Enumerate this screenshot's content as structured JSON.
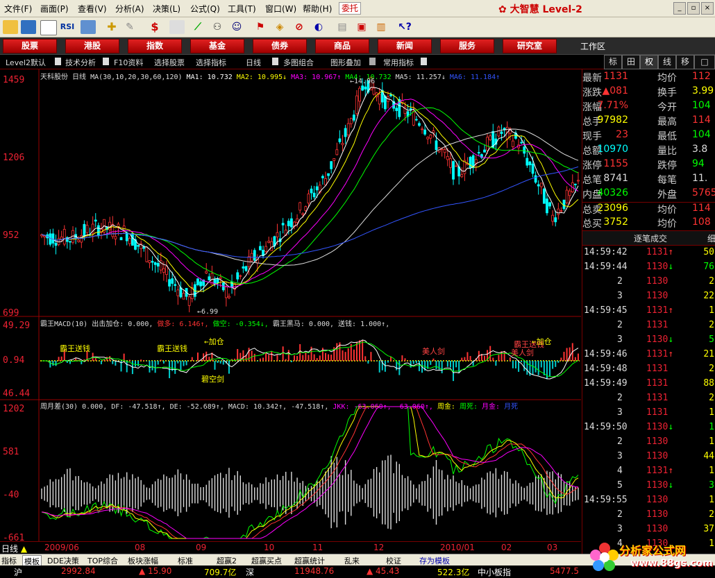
{
  "menu": [
    "文件(F)",
    "画面(P)",
    "查看(V)",
    "分析(A)",
    "决策(L)",
    "公式(Q)",
    "工具(T)",
    "窗口(W)",
    "帮助(H)"
  ],
  "weituo": "委托",
  "brand": {
    "name": "大智慧",
    "level": "Level-2"
  },
  "nav": [
    "股票",
    "港股",
    "指数",
    "基金",
    "债券",
    "商品",
    "新闻",
    "服务",
    "研究室"
  ],
  "workspace": "工作区",
  "subtabs": [
    "Level2默认",
    "技术分析",
    "F10资料",
    "选择股票",
    "选择指标",
    "日线",
    "多图组合",
    "图形叠加",
    "常用指标"
  ],
  "right_tabs": [
    "标",
    "田",
    "权",
    "线",
    "移",
    "□"
  ],
  "chart": {
    "stock_title": "天科股份 日线",
    "ma_params": "MA(30,10,20,30,60,120)",
    "ma_values": [
      {
        "label": "MA1: 10.732",
        "color": "#ffffff"
      },
      {
        "label": "MA2: 10.995↓",
        "color": "#ffff00"
      },
      {
        "label": "MA3: 10.967↑",
        "color": "#ff00ff"
      },
      {
        "label": "MA4: 10.732",
        "color": "#00ff00"
      },
      {
        "label": "MA5: 11.257↓",
        "color": "#dddddd"
      },
      {
        "label": "MA6: 11.184↑",
        "color": "#3355ff"
      }
    ],
    "price_labels": [
      "1459",
      "1206",
      "952",
      "699"
    ],
    "high_mark": "←14.96",
    "low_mark": "←6.99",
    "macd_title": "霸王MACD(10)",
    "macd_legend": [
      {
        "label": "出击加仓: 0.000,",
        "color": "#dddddd"
      },
      {
        "label": "做多: 6.146↑,",
        "color": "#ff3333"
      },
      {
        "label": "做空: -0.354↓,",
        "color": "#00ff00"
      },
      {
        "label": "霸王黑马: 0.000,",
        "color": "#dddddd"
      },
      {
        "label": "送钱: 1.000↑,",
        "color": "#dddddd"
      }
    ],
    "macd_labels": [
      "49.29",
      "0.94",
      "46.44"
    ],
    "macd_annotations": [
      "霸王送钱",
      "霸王送钱",
      "←加仓",
      "碧空剑",
      "美人剑",
      "霸王送钱",
      "←加仓",
      "美人剑"
    ],
    "zcy_title": "周月差(30)",
    "zcy_legend": [
      {
        "label": "0.000,",
        "color": "#dddddd"
      },
      {
        "label": "DF: -47.518↑,",
        "color": "#dddddd"
      },
      {
        "label": "DE: -52.689↑,",
        "color": "#dddddd"
      },
      {
        "label": "MACD: 10.342↑,",
        "color": "#dddddd"
      },
      {
        "label": "-47.518↑,",
        "color": "#dddddd"
      },
      {
        "label": "JKK: -63.060↑,",
        "color": "#ff00ff"
      },
      {
        "label": "-63.060↑,",
        "color": "#ff00ff"
      },
      {
        "label": "周金:",
        "color": "#ffff00"
      },
      {
        "label": "周死:",
        "color": "#00ff00"
      },
      {
        "label": "月金:",
        "color": "#ff00ff"
      },
      {
        "label": "月死",
        "color": "#3355ff"
      }
    ],
    "zcy_labels": [
      "1202",
      "581",
      "-40",
      "-661"
    ],
    "x_dates": [
      "2009/06",
      "08",
      "09",
      "10",
      "11",
      "12",
      "2010/01",
      "02",
      "03"
    ],
    "period": "日线"
  },
  "quotes": [
    {
      "k": "最新",
      "v": "1131",
      "vc": "#ff3333",
      "k2": "均价",
      "v2": "112",
      "v2c": "#ff3333"
    },
    {
      "k": "涨跌",
      "v": "▲081",
      "vc": "#ff3333",
      "k2": "换手",
      "v2": "3.99",
      "v2c": "#ffff00"
    },
    {
      "k": "涨幅",
      "v": "7.71%",
      "vc": "#ff3333",
      "k2": "今开",
      "v2": "104",
      "v2c": "#00ff00"
    },
    {
      "k": "总手",
      "v": "97982",
      "vc": "#ffff00",
      "k2": "最高",
      "v2": "114",
      "v2c": "#ff3333"
    },
    {
      "k": "现手",
      "v": "23",
      "vc": "#ff3333",
      "k2": "最低",
      "v2": "104",
      "v2c": "#00ff00"
    },
    {
      "k": "总额",
      "v": "10970",
      "vc": "#00ffff",
      "k2": "量比",
      "v2": "3.8",
      "v2c": "#dddddd"
    },
    {
      "k": "涨停",
      "v": "1155",
      "vc": "#ff3333",
      "k2": "跌停",
      "v2": "94",
      "v2c": "#00ff00"
    },
    {
      "k": "总笔",
      "v": "8741",
      "vc": "#dddddd",
      "k2": "每笔",
      "v2": "11.",
      "v2c": "#dddddd"
    },
    {
      "k": "内盘",
      "v": "40326",
      "vc": "#00ff00",
      "k2": "外盘",
      "v2": "5765",
      "v2c": "#ff3333"
    },
    {
      "k": "总卖",
      "v": "23096",
      "vc": "#ffff00",
      "k2": "均价",
      "v2": "114",
      "v2c": "#ff3333"
    },
    {
      "k": "总买",
      "v": "3752",
      "vc": "#ffff00",
      "k2": "均价",
      "v2": "108",
      "v2c": "#ff3333"
    }
  ],
  "ticks_header": "逐笔成交",
  "ticks_header2": "细",
  "ticks": [
    {
      "t": "14:59:42",
      "p": "1131",
      "a": "↑",
      "ac": "#ff3333",
      "v": "50",
      "vc": "#ffff00"
    },
    {
      "t": "14:59:44",
      "p": "1130",
      "a": "↓",
      "ac": "#00ff00",
      "v": "76",
      "vc": "#00ff00"
    },
    {
      "t": "2",
      "p": "1130",
      "a": "",
      "ac": "",
      "v": "2",
      "vc": "#ffff00"
    },
    {
      "t": "3",
      "p": "1130",
      "a": "",
      "ac": "",
      "v": "22",
      "vc": "#ffff00"
    },
    {
      "t": "14:59:45",
      "p": "1131",
      "a": "↑",
      "ac": "#ff3333",
      "v": "1",
      "vc": "#ffff00"
    },
    {
      "t": "2",
      "p": "1131",
      "a": "",
      "ac": "",
      "v": "2",
      "vc": "#ffff00"
    },
    {
      "t": "3",
      "p": "1130",
      "a": "↓",
      "ac": "#00ff00",
      "v": "5",
      "vc": "#00ff00"
    },
    {
      "t": "14:59:46",
      "p": "1131",
      "a": "↑",
      "ac": "#ff3333",
      "v": "21",
      "vc": "#ffff00"
    },
    {
      "t": "14:59:48",
      "p": "1131",
      "a": "",
      "ac": "",
      "v": "2",
      "vc": "#ffff00"
    },
    {
      "t": "14:59:49",
      "p": "1131",
      "a": "",
      "ac": "",
      "v": "88",
      "vc": "#ffff00"
    },
    {
      "t": "2",
      "p": "1131",
      "a": "",
      "ac": "",
      "v": "2",
      "vc": "#ffff00"
    },
    {
      "t": "3",
      "p": "1131",
      "a": "",
      "ac": "",
      "v": "1",
      "vc": "#ffff00"
    },
    {
      "t": "14:59:50",
      "p": "1130",
      "a": "↓",
      "ac": "#00ff00",
      "v": "1",
      "vc": "#00ff00"
    },
    {
      "t": "2",
      "p": "1130",
      "a": "",
      "ac": "",
      "v": "1",
      "vc": "#ffff00"
    },
    {
      "t": "3",
      "p": "1130",
      "a": "",
      "ac": "",
      "v": "44",
      "vc": "#ffff00"
    },
    {
      "t": "4",
      "p": "1131",
      "a": "↑",
      "ac": "#ff3333",
      "v": "1",
      "vc": "#ffff00"
    },
    {
      "t": "5",
      "p": "1130",
      "a": "↓",
      "ac": "#00ff00",
      "v": "3",
      "vc": "#00ff00"
    },
    {
      "t": "14:59:55",
      "p": "1130",
      "a": "",
      "ac": "",
      "v": "1",
      "vc": "#ffff00"
    },
    {
      "t": "2",
      "p": "1130",
      "a": "",
      "ac": "",
      "v": "2",
      "vc": "#ffff00"
    },
    {
      "t": "3",
      "p": "1130",
      "a": "",
      "ac": "",
      "v": "37",
      "vc": "#ffff00"
    },
    {
      "t": "4",
      "p": "1130",
      "a": "",
      "ac": "",
      "v": "1",
      "vc": "#ffff00"
    }
  ],
  "bottom_tabs": [
    "指标",
    "模板",
    "DDE决策",
    "TOP综合",
    "板块涨幅",
    "标准",
    "超赢2",
    "超赢买点",
    "超赢统计",
    "乱来",
    "校证",
    "存为模板"
  ],
  "index_bar": [
    {
      "text": "沪",
      "color": "#ffffff"
    },
    {
      "text": "2992.84",
      "color": "#ff3333"
    },
    {
      "text": "▲ 15.90",
      "color": "#ff3333"
    },
    {
      "text": "709.7亿",
      "color": "#ffff00"
    },
    {
      "text": "深",
      "color": "#ffffff"
    },
    {
      "text": "11948.76",
      "color": "#ff3333"
    },
    {
      "text": "▲ 45.43",
      "color": "#ff3333"
    },
    {
      "text": "522.3亿",
      "color": "#ffff00"
    },
    {
      "text": "中小板指",
      "color": "#ffffff"
    },
    {
      "text": "5477.5",
      "color": "#ff3333"
    }
  ],
  "watermark": {
    "site": "分析家公式网",
    "url": "www.88gs.com"
  },
  "chart_data": {
    "type": "candlestick",
    "x_ticks": [
      "2009/06",
      "08",
      "09",
      "10",
      "11",
      "12",
      "2010/01",
      "02",
      "03"
    ],
    "price_axis": [
      6.99,
      9.52,
      12.06,
      14.59
    ],
    "high": 14.96,
    "low": 6.99,
    "last_close": 11.31,
    "macd_axis": [
      -46.44,
      0.94,
      49.29
    ],
    "zcy_axis": [
      -661,
      -40,
      581,
      1202
    ]
  }
}
